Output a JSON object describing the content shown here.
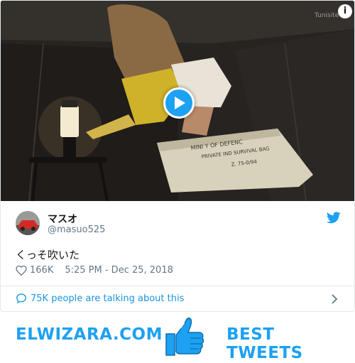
{
  "tweet": {
    "display_name": "マスオ",
    "handle": "@masuo525",
    "text": "くっそ吹いた",
    "likes": "166K",
    "timestamp": "5:25 PM - Dec 25, 2018",
    "conversation": "75K people are talking about this"
  },
  "media": {
    "info_label": "i",
    "bag_text_1": "MINI  Y OF DEFENC",
    "bag_text_2": "PRIVATE  IND SURVIVAL BAG",
    "bag_text_3": "Z.  75-0/94",
    "channel_logo": "Tunisite"
  },
  "footer": {
    "site_name": "ELWIZARA.COM",
    "tagline": "BEST TWEETS"
  },
  "colors": {
    "twitter_blue": "#1da1f2",
    "link_blue": "#1b95e0",
    "text": "#14171a",
    "muted": "#657786"
  },
  "icons": {
    "play": "play-icon",
    "info": "info-icon",
    "bird": "twitter-bird-icon",
    "heart": "heart-icon",
    "bubble": "speech-bubble-icon",
    "chevron": "chevron-right-icon",
    "thumb": "thumbs-up-icon"
  }
}
